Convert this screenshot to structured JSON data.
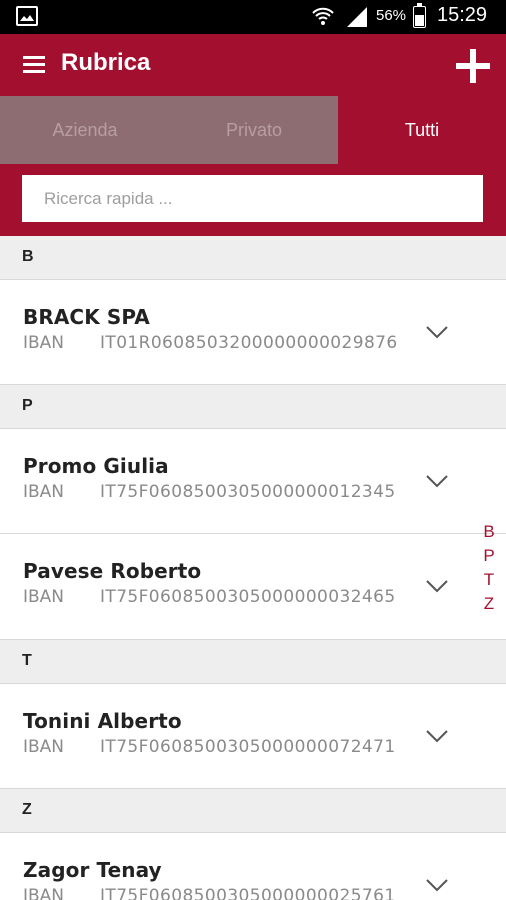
{
  "status_bar": {
    "battery": "56%",
    "time": "15:29",
    "battery_level": 0.56
  },
  "app_bar": {
    "title": "Rubrica",
    "menu_icon": "hamburger-menu-icon",
    "add_icon": "plus-icon"
  },
  "tabs": [
    {
      "label": "Azienda",
      "active": false
    },
    {
      "label": "Privato",
      "active": false
    },
    {
      "label": "Tutti",
      "active": true
    }
  ],
  "search": {
    "placeholder": "Ricerca rapida ..."
  },
  "sections": [
    {
      "letter": "B",
      "contacts": [
        {
          "name": "BRACK SPA",
          "iban_label": "IBAN",
          "iban": "IT01R0608503200000000029876"
        }
      ]
    },
    {
      "letter": "P",
      "contacts": [
        {
          "name": "Promo Giulia",
          "iban_label": "IBAN",
          "iban": "IT75F0608500305000000012345"
        },
        {
          "name": "Pavese Roberto",
          "iban_label": "IBAN",
          "iban": "IT75F0608500305000000032465"
        }
      ]
    },
    {
      "letter": "T",
      "contacts": [
        {
          "name": "Tonini Alberto",
          "iban_label": "IBAN",
          "iban": "IT75F0608500305000000072471"
        }
      ]
    },
    {
      "letter": "Z",
      "contacts": [
        {
          "name": "Zagor Tenay",
          "iban_label": "IBAN",
          "iban": "IT75F0608500305000000025761"
        }
      ]
    }
  ],
  "index": [
    "B",
    "P",
    "T",
    "Z"
  ],
  "colors": {
    "brand": "#a3102f",
    "tab_inactive_bg": "#8d6d72",
    "section_bg": "#eeeeee"
  }
}
